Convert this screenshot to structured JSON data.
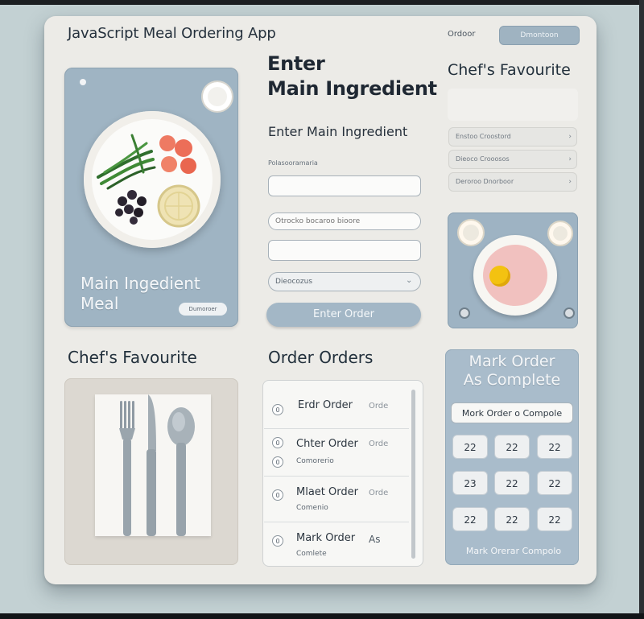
{
  "header": {
    "app_title": "JavaScript Meal Ordering App",
    "link_label": "Ordoor",
    "button_label": "Dmontoon"
  },
  "meal_card": {
    "title_line1": "Main Ingedient",
    "title_line2": "Meal",
    "button_label": "Dumoroer"
  },
  "form": {
    "heading_line1": "Enter",
    "heading_line2": "Main Ingredient",
    "subheading": "Enter Main Ingredient",
    "field_label": "Polasooramaria",
    "ingredient_value": "",
    "secondary_placeholder": "Otrocko bocaroo bioore",
    "third_value": "",
    "select_value": "Dieocozus",
    "submit_label": "Enter Order"
  },
  "chefs_favourite": {
    "title": "Chef's Favourite",
    "items": [
      "Enstoo Croostord",
      "Dieoco Crooosos",
      "Deroroo Dnorboor"
    ]
  },
  "cutlery": {
    "title": "Chef's Favourite"
  },
  "orders": {
    "title": "Order Orders",
    "rows": [
      {
        "main": "Erdr Order",
        "faint": "Orde",
        "sub": ""
      },
      {
        "main": "Chter Order",
        "faint": "Orde",
        "sub": "Comorerio"
      },
      {
        "main": "Mlaet Order",
        "faint": "Orde",
        "sub": "Comenio"
      },
      {
        "main": "Mark Order",
        "faint": "As",
        "sub": "Comlete"
      }
    ]
  },
  "complete": {
    "title_line1": "Mark Order",
    "title_line2": "As Complete",
    "field_value": "Mork Order o Compole",
    "keys": [
      "22",
      "22",
      "22",
      "23",
      "22",
      "22",
      "22",
      "22",
      "22"
    ],
    "button_label": "Mark Orerar Compolo"
  },
  "colors": {
    "accent_blue": "#9fb4c3",
    "panel_bg": "#ecebe7",
    "page_bg": "#c3d1d3",
    "yolk": "#f3c211",
    "soup": "#f1c1bf",
    "tomato": "#ee7a63"
  }
}
